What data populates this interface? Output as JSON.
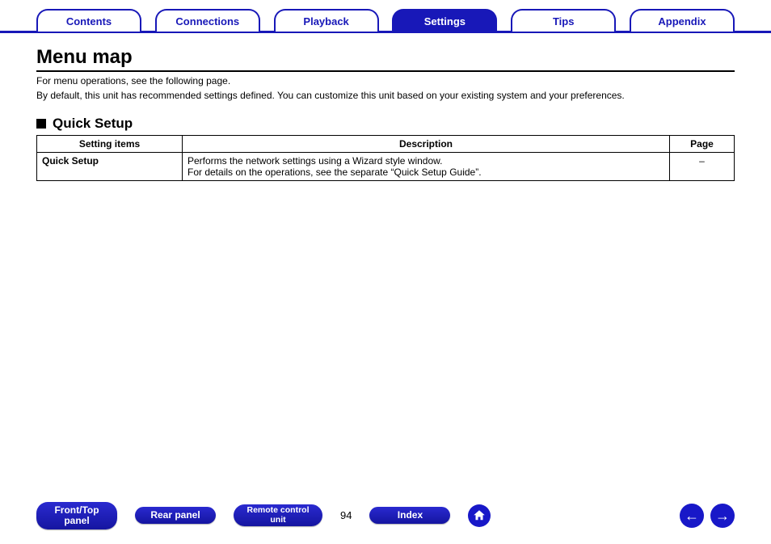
{
  "tabs": {
    "items": [
      "Contents",
      "Connections",
      "Playback",
      "Settings",
      "Tips",
      "Appendix"
    ],
    "active_index": 3
  },
  "title": "Menu map",
  "intro": {
    "line1": "For menu operations, see the following page.",
    "line2": "By default, this unit has recommended settings defined. You can customize this unit based on your existing system and your preferences."
  },
  "section": {
    "heading": "Quick Setup",
    "table": {
      "headers": [
        "Setting items",
        "Description",
        "Page"
      ],
      "row": {
        "item": "Quick Setup",
        "desc_line1": "Performs the network settings using a Wizard style window.",
        "desc_line2": "For details on the operations, see the separate “Quick Setup Guide”.",
        "page": "–"
      }
    }
  },
  "footer": {
    "buttons": {
      "front_top_l1": "Front/Top",
      "front_top_l2": "panel",
      "rear": "Rear panel",
      "remote_l1": "Remote control",
      "remote_l2": "unit",
      "index": "Index"
    },
    "page_number": "94"
  }
}
